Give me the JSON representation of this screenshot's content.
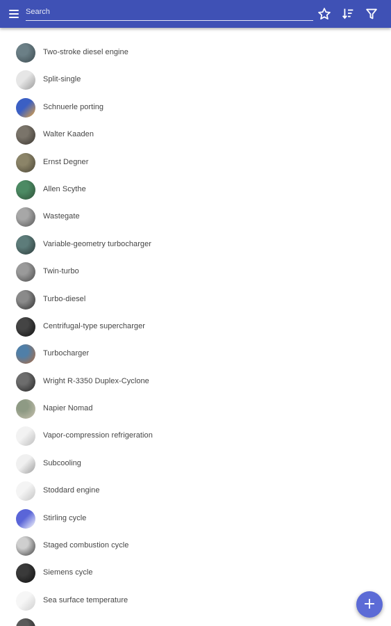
{
  "appbar": {
    "menu_icon": "menu-icon",
    "search_placeholder": "Search",
    "search_value": "",
    "actions": [
      "star-icon",
      "sort-icon",
      "filter-icon"
    ],
    "color": "#3f51b5"
  },
  "list": {
    "items": [
      {
        "label": "Two-stroke diesel engine",
        "thumb": "photo-thumbnail",
        "colors": [
          "#6b7f86",
          "#3b4a4f"
        ]
      },
      {
        "label": "Split-single",
        "thumb": "drawing-thumbnail",
        "colors": [
          "#e6e6e6",
          "#9a9a9a"
        ]
      },
      {
        "label": "Schnuerle porting",
        "thumb": "diagram-thumbnail",
        "colors": [
          "#3b5fc4",
          "#e9a53a"
        ]
      },
      {
        "label": "Walter Kaaden",
        "thumb": "photo-thumbnail",
        "colors": [
          "#7a746a",
          "#3a352f"
        ]
      },
      {
        "label": "Ernst Degner",
        "thumb": "photo-thumbnail",
        "colors": [
          "#8b8468",
          "#4a4535"
        ]
      },
      {
        "label": "Allen Scythe",
        "thumb": "photo-thumbnail",
        "colors": [
          "#4c8a63",
          "#2d5037"
        ]
      },
      {
        "label": "Wastegate",
        "thumb": "photo-thumbnail",
        "colors": [
          "#a7a7a7",
          "#555555"
        ]
      },
      {
        "label": "Variable-geometry turbocharger",
        "thumb": "photo-thumbnail",
        "colors": [
          "#5d7c7a",
          "#2b3a39"
        ]
      },
      {
        "label": "Twin-turbo",
        "thumb": "photo-thumbnail",
        "colors": [
          "#9a9a9a",
          "#4a4a4a"
        ]
      },
      {
        "label": "Turbo-diesel",
        "thumb": "photo-thumbnail",
        "colors": [
          "#8a8a8a",
          "#2e2e2e"
        ]
      },
      {
        "label": "Centrifugal-type supercharger",
        "thumb": "photo-thumbnail",
        "colors": [
          "#444444",
          "#111111"
        ]
      },
      {
        "label": "Turbocharger",
        "thumb": "photo-thumbnail",
        "colors": [
          "#4f7fa8",
          "#b46a3c"
        ]
      },
      {
        "label": "Wright R-3350 Duplex-Cyclone",
        "thumb": "photo-thumbnail",
        "colors": [
          "#6d6d6d",
          "#252525"
        ]
      },
      {
        "label": "Napier Nomad",
        "thumb": "photo-thumbnail",
        "colors": [
          "#8e9a84",
          "#c9c2b0"
        ]
      },
      {
        "label": "Vapor-compression refrigeration",
        "thumb": "diagram-thumbnail",
        "colors": [
          "#f2f2f2",
          "#bdbdbd"
        ]
      },
      {
        "label": "Subcooling",
        "thumb": "diagram-thumbnail",
        "colors": [
          "#f0f0f0",
          "#9e9e9e"
        ]
      },
      {
        "label": "Stoddard engine",
        "thumb": "diagram-thumbnail",
        "colors": [
          "#f4f4f4",
          "#c4c4c4"
        ]
      },
      {
        "label": "Stirling cycle",
        "thumb": "diagram-thumbnail",
        "colors": [
          "#5a65d8",
          "#ffffff"
        ]
      },
      {
        "label": "Staged combustion cycle",
        "thumb": "photo-thumbnail",
        "colors": [
          "#cfcfcf",
          "#3f3f3f"
        ]
      },
      {
        "label": "Siemens cycle",
        "thumb": "photo-thumbnail",
        "colors": [
          "#3a3a3a",
          "#0f0f0f"
        ]
      },
      {
        "label": "Sea surface temperature",
        "thumb": "diagram-thumbnail",
        "colors": [
          "#f6f6f6",
          "#cfcfcf"
        ]
      },
      {
        "label": "",
        "thumb": "photo-thumbnail",
        "colors": [
          "#5a5a5a",
          "#1c1c1c"
        ]
      }
    ]
  },
  "fab": {
    "icon": "plus-icon",
    "glyph": "+",
    "color": "#5c6bd6"
  }
}
